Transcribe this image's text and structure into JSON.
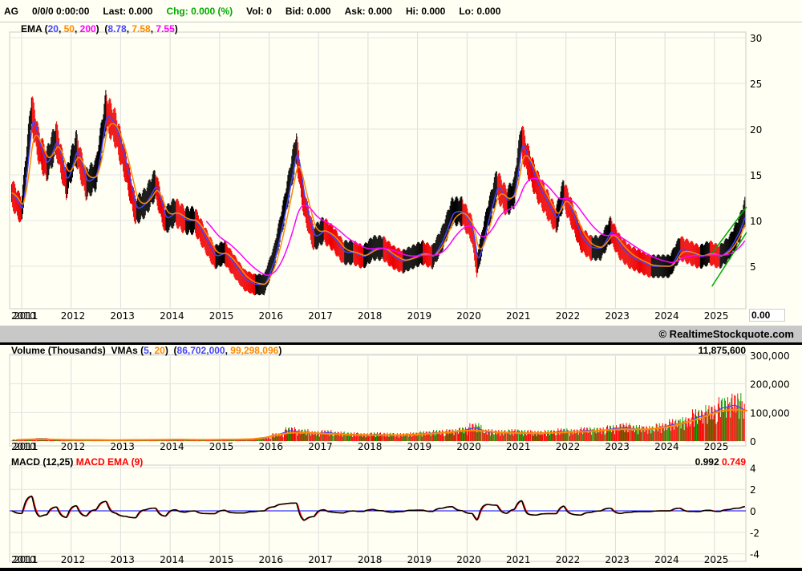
{
  "header": {
    "symbol": "AG",
    "datetime": "0/0/0 0:00:00",
    "last": "Last: 0.000",
    "chg": "Chg: 0.000 (%)",
    "vol": "Vol: 0",
    "bid": "Bid: 0.000",
    "ask": "Ask: 0.000",
    "hi": "Hi: 0.000",
    "lo": "Lo: 0.000"
  },
  "price_legend": {
    "name": "EMA",
    "p1": "20",
    "p2": "50",
    "p3": "200",
    "v1": "8.78",
    "v2": "7.58",
    "v3": "7.55"
  },
  "price_last_box": "0.00",
  "copyright": "© RealtimeStockquote.com",
  "volume_legend": {
    "name": "Volume (Thousands)",
    "vma": "VMAs",
    "p1": "5",
    "p2": "20",
    "v1": "86,702,000",
    "v2": "99,298,096",
    "last": "11,875,600"
  },
  "macd_legend": {
    "name": "MACD (12,25)",
    "ema": "MACD EMA (9)",
    "v1": "0.992",
    "v2": "0.749"
  },
  "colors": {
    "up": "#00aa00",
    "down": "#ff0000",
    "ema20": "#4444ff",
    "ema50": "#ff8800",
    "ema200": "#ff00ff",
    "macd": "#000000",
    "signal": "#ff0000",
    "trend": "#00aa00"
  },
  "chart_data": [
    {
      "type": "line",
      "panel": "price",
      "ylim": [
        0,
        30
      ],
      "yticks": [
        "30",
        "25",
        "20",
        "15",
        "10",
        "5"
      ],
      "x_labels": [
        "2010",
        "2011",
        "2012",
        "2013",
        "2014",
        "2015",
        "2016",
        "2017",
        "2018",
        "2019",
        "2020",
        "2021",
        "2022",
        "2023",
        "2024",
        "2025"
      ],
      "x": [
        2010.8,
        2011.0,
        2011.2,
        2011.35,
        2011.5,
        2011.7,
        2011.9,
        2012.1,
        2012.3,
        2012.5,
        2012.7,
        2012.9,
        2013.1,
        2013.3,
        2013.5,
        2013.7,
        2013.9,
        2014.1,
        2014.3,
        2014.5,
        2014.7,
        2014.9,
        2015.1,
        2015.3,
        2015.5,
        2015.7,
        2015.9,
        2016.1,
        2016.3,
        2016.55,
        2016.7,
        2016.9,
        2017.1,
        2017.3,
        2017.5,
        2017.7,
        2017.9,
        2018.1,
        2018.3,
        2018.5,
        2018.7,
        2018.9,
        2019.1,
        2019.3,
        2019.5,
        2019.7,
        2019.9,
        2020.1,
        2020.2,
        2020.4,
        2020.6,
        2020.8,
        2020.95,
        2021.1,
        2021.2,
        2021.4,
        2021.6,
        2021.8,
        2021.95,
        2022.1,
        2022.3,
        2022.5,
        2022.7,
        2022.9,
        2023.1,
        2023.3,
        2023.5,
        2023.7,
        2023.9,
        2024.1,
        2024.3,
        2024.5,
        2024.7,
        2024.9,
        2025.1,
        2025.3,
        2025.5,
        2025.62
      ],
      "close": [
        13,
        11,
        22,
        18,
        16,
        19,
        14,
        18,
        14,
        15,
        22,
        20,
        16,
        11,
        12,
        14,
        10,
        11,
        10,
        10,
        8,
        6,
        6.5,
        5,
        3.5,
        3,
        3,
        6,
        11,
        18,
        12,
        8,
        9,
        8,
        6.5,
        6.5,
        6,
        7,
        7,
        6,
        5.5,
        6,
        6.5,
        6,
        8,
        11,
        11,
        9,
        5,
        10,
        14,
        12,
        13,
        19,
        17,
        14,
        12,
        10,
        13,
        11,
        8,
        7,
        7,
        9,
        7,
        6,
        5.5,
        5,
        5,
        5,
        7,
        6.5,
        6,
        6.5,
        6,
        7,
        9,
        11
      ],
      "series": [
        {
          "name": "EMA 20"
        },
        {
          "name": "EMA 50"
        },
        {
          "name": "EMA 200"
        }
      ],
      "trendlines": [
        {
          "from": [
            2024.95,
            2.8
          ],
          "to": [
            2025.65,
            8.7
          ]
        },
        {
          "from": [
            2024.95,
            6.4
          ],
          "to": [
            2025.65,
            11.5
          ]
        }
      ]
    },
    {
      "type": "bar",
      "panel": "volume",
      "ylim": [
        0,
        300000
      ],
      "yticks": [
        "300,000",
        "200,000",
        "100,000",
        "0"
      ],
      "x_start": 2010.8,
      "x_step": 0.25,
      "values": [
        4000,
        6000,
        8000,
        5000,
        4000,
        5000,
        4000,
        4000,
        3000,
        4000,
        5000,
        4000,
        5000,
        6000,
        5000,
        4000,
        5000,
        6000,
        5000,
        7000,
        9000,
        20000,
        35000,
        30000,
        25000,
        28000,
        24000,
        22000,
        20000,
        22000,
        21000,
        20000,
        22000,
        25000,
        28000,
        30000,
        35000,
        45000,
        30000,
        28000,
        30000,
        28000,
        26000,
        28000,
        32000,
        30000,
        35000,
        34000,
        40000,
        45000,
        40000,
        38000,
        45000,
        55000,
        60000,
        80000,
        90000,
        110000,
        120000,
        100000
      ]
    },
    {
      "type": "line",
      "panel": "macd",
      "ylim": [
        -4,
        4
      ],
      "yticks": [
        "4",
        "2",
        "0",
        "-2",
        "-4"
      ],
      "series": [
        {
          "name": "MACD (12,25)"
        },
        {
          "name": "MACD EMA (9)"
        }
      ]
    }
  ]
}
